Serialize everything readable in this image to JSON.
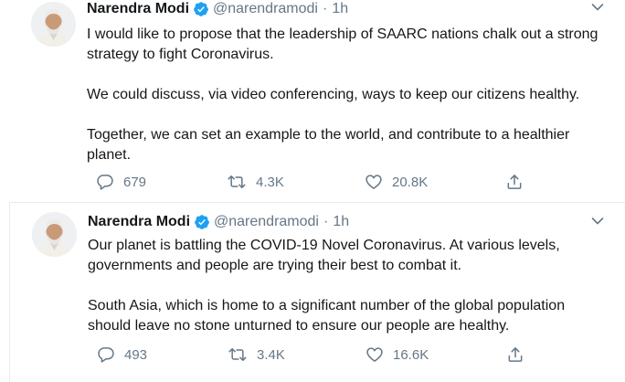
{
  "tweets": [
    {
      "author": {
        "name": "Narendra Modi",
        "handle": "@narendramodi",
        "time": "1h"
      },
      "paragraphs": [
        "I would like to propose that the leadership of SAARC nations chalk out a strong strategy to fight Coronavirus.",
        "We could discuss, via video conferencing, ways to keep our citizens healthy.",
        "Together, we can set an example to the world, and contribute to a healthier planet."
      ],
      "stats": {
        "replies": "679",
        "retweets": "4.3K",
        "likes": "20.8K"
      }
    },
    {
      "author": {
        "name": "Narendra Modi",
        "handle": "@narendramodi",
        "time": "1h"
      },
      "paragraphs": [
        "Our planet is battling the COVID-19 Novel Coronavirus. At various levels, governments and people are trying their best to combat it.",
        "South Asia, which is home to a significant number of the global population should leave no stone unturned to ensure our people are healthy."
      ],
      "stats": {
        "replies": "493",
        "retweets": "3.4K",
        "likes": "16.6K"
      }
    }
  ],
  "separator": "·",
  "icons": {
    "verified": "verified-badge-icon",
    "menu": "chevron-down-icon",
    "reply": "reply-icon",
    "retweet": "retweet-icon",
    "like": "heart-icon",
    "share": "share-icon"
  },
  "colors": {
    "text": "#14171a",
    "muted": "#657786",
    "verified": "#1da1f2",
    "border": "#e6ecf0"
  }
}
